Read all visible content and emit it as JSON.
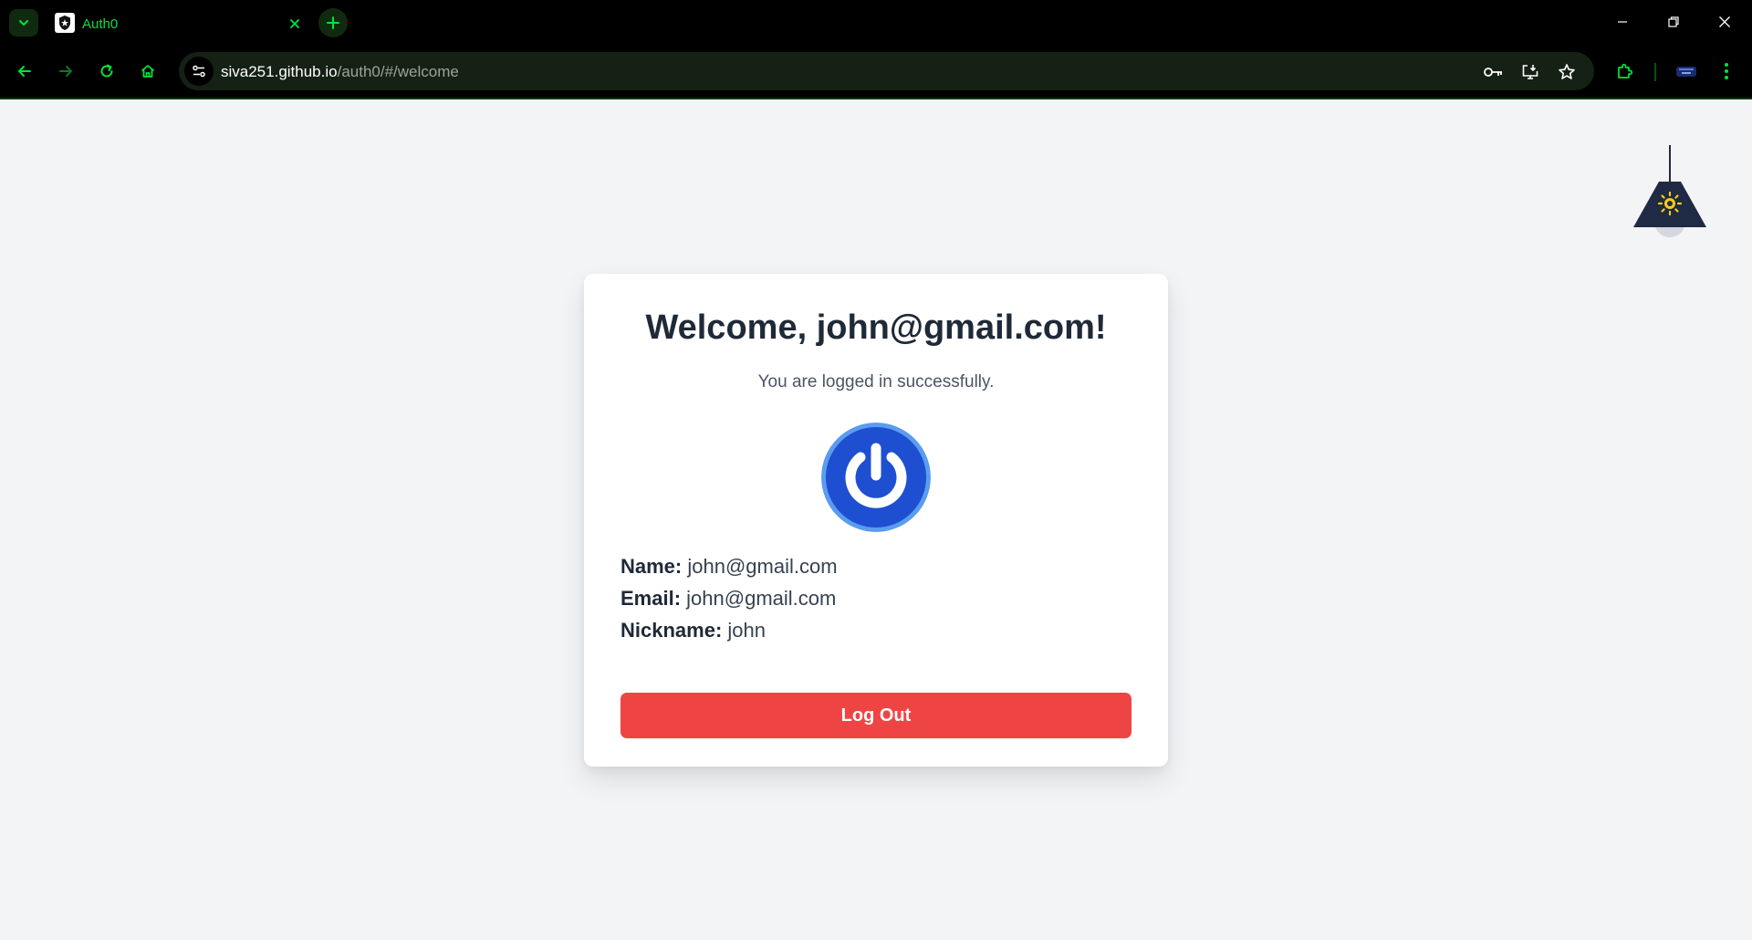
{
  "browser": {
    "tab": {
      "title": "Auth0"
    },
    "address_bar": {
      "host": "siva251.github.io",
      "path": "/auth0/#/welcome"
    },
    "accent_color": "#00e53b"
  },
  "page": {
    "theme_toggle_icon": "sun-icon",
    "welcome": {
      "title": "Welcome, john@gmail.com!",
      "subtitle": "You are logged in successfully."
    },
    "profile": {
      "avatar_icon": "power-icon",
      "name_label": "Name:",
      "name_value": "john@gmail.com",
      "email_label": "Email:",
      "email_value": "john@gmail.com",
      "nickname_label": "Nickname:",
      "nickname_value": "john"
    },
    "logout_label": "Log Out",
    "logout_color": "#ef4444"
  }
}
